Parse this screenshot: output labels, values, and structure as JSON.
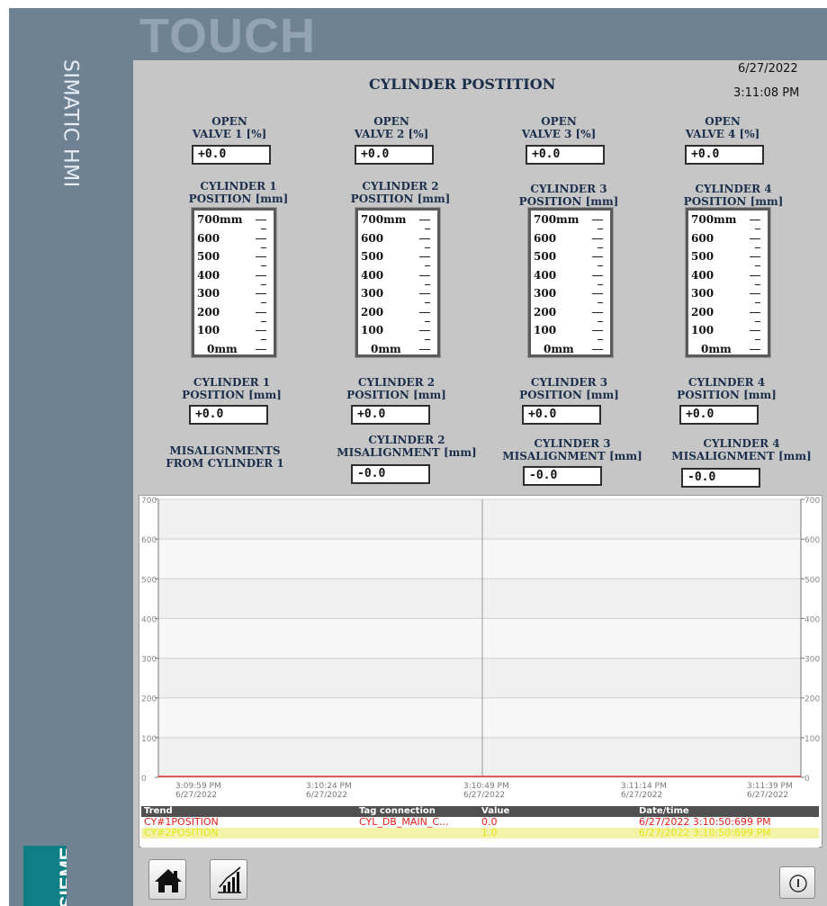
{
  "brand": {
    "hmi_label": "SIMATIC HMI",
    "logo": "TOUCH",
    "siemens": "SIEMENS"
  },
  "header": {
    "title": "CYLINDER POSTITION",
    "date": "6/27/2022",
    "time": "3:11:08 PM"
  },
  "valves": [
    {
      "label1": "OPEN",
      "label2": "VALVE 1 [%]",
      "value": "+0.0"
    },
    {
      "label1": "OPEN",
      "label2": "VALVE 2 [%]",
      "value": "+0.0"
    },
    {
      "label1": "OPEN",
      "label2": "VALVE 3 [%]",
      "value": "+0.0"
    },
    {
      "label1": "OPEN",
      "label2": "VALVE 4 [%]",
      "value": "+0.0"
    }
  ],
  "bar_titles": [
    {
      "l1": "CYLINDER 1",
      "l2": "POSITION [mm]"
    },
    {
      "l1": "CYLINDER 2",
      "l2": "POSITION [mm]"
    },
    {
      "l1": "CYLINDER 3",
      "l2": "POSITION [mm]"
    },
    {
      "l1": "CYLINDER 4",
      "l2": "POSITION [mm]"
    }
  ],
  "bar_scale": [
    "700mm",
    "600",
    "500",
    "400",
    "300",
    "200",
    "100",
    "0mm"
  ],
  "positions": [
    {
      "l1": "CYLINDER 1",
      "l2": "POSITION [mm]",
      "value": "+0.0"
    },
    {
      "l1": "CYLINDER 2",
      "l2": "POSITION [mm]",
      "value": "+0.0"
    },
    {
      "l1": "CYLINDER 3",
      "l2": "POSITION [mm]",
      "value": "+0.0"
    },
    {
      "l1": "CYLINDER 4",
      "l2": "POSITION [mm]",
      "value": "+0.0"
    }
  ],
  "misalign_header": {
    "l1": "MISALIGNMENTS",
    "l2": "FROM CYLINDER 1"
  },
  "misalignments": [
    {
      "l1": "CYLINDER 2",
      "l2": "MISALIGNMENT [mm]",
      "value": "-0.0"
    },
    {
      "l1": "CYLINDER 3",
      "l2": "MISALIGNMENT [mm]",
      "value": "-0.0"
    },
    {
      "l1": "CYLINDER 4",
      "l2": "MISALIGNMENT [mm]",
      "value": "-0.0"
    }
  ],
  "trend": {
    "y_ticks": [
      "700",
      "600",
      "500",
      "400",
      "300",
      "200",
      "100",
      "0"
    ],
    "x_ticks": [
      {
        "time": "3:09:59 PM",
        "date": "6/27/2022"
      },
      {
        "time": "3:10:24 PM",
        "date": "6/27/2022"
      },
      {
        "time": "3:10:49 PM",
        "date": "6/27/2022"
      },
      {
        "time": "3:11:14 PM",
        "date": "6/27/2022"
      },
      {
        "time": "3:11:39 PM",
        "date": "6/27/2022"
      }
    ],
    "line_color": "#e0302a"
  },
  "legend": {
    "headers": {
      "trend": "Trend",
      "tag": "Tag connection",
      "value": "Value",
      "datetime": "Date/time"
    },
    "rows": [
      {
        "trend": "CY#1POSITION",
        "tag": "CYL_DB_MAIN_C...",
        "value": "0.0",
        "datetime": "6/27/2022 3:10:50:699 PM",
        "color": "#e0201a",
        "bg": "#ffffff"
      },
      {
        "trend": "CY#2POSITION",
        "tag": "",
        "value": "1.0",
        "datetime": "6/27/2022 3:10:50:699 PM",
        "color": "#e5e51a",
        "bg": "#f2f2a8"
      }
    ]
  },
  "buttons": {
    "home": "home-icon",
    "trend": "trend-chart-icon",
    "power": "info-power-icon"
  }
}
